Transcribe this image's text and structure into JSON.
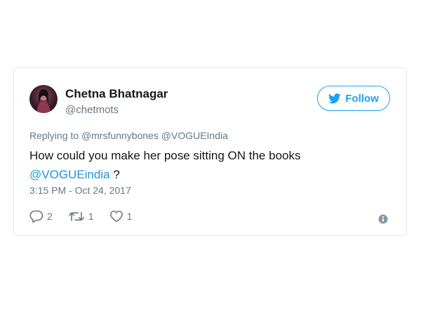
{
  "tweet": {
    "author": {
      "display_name": "Chetna Bhatnagar",
      "handle": "@chetmots",
      "avatar_icon": "profile-photo"
    },
    "follow_button": {
      "label": "Follow",
      "icon": "twitter-bird-icon"
    },
    "reply_context": {
      "prefix": "Replying to",
      "mentions": [
        "@mrsfunnybones",
        "@VOGUEIndia"
      ]
    },
    "text": {
      "body": "How could you make her pose sitting ON the books",
      "mention": "@VOGUEindia",
      "suffix": "?"
    },
    "timestamp": "3:15 PM - Oct 24, 2017",
    "actions": {
      "replies": "2",
      "retweets": "1",
      "likes": "1"
    },
    "info_icon": "info-icon"
  },
  "colors": {
    "accent": "#1da1f2",
    "mention": "#1b95e0",
    "secondary_text": "#657786",
    "primary_text": "#14171a",
    "border": "#e1e8ed"
  }
}
